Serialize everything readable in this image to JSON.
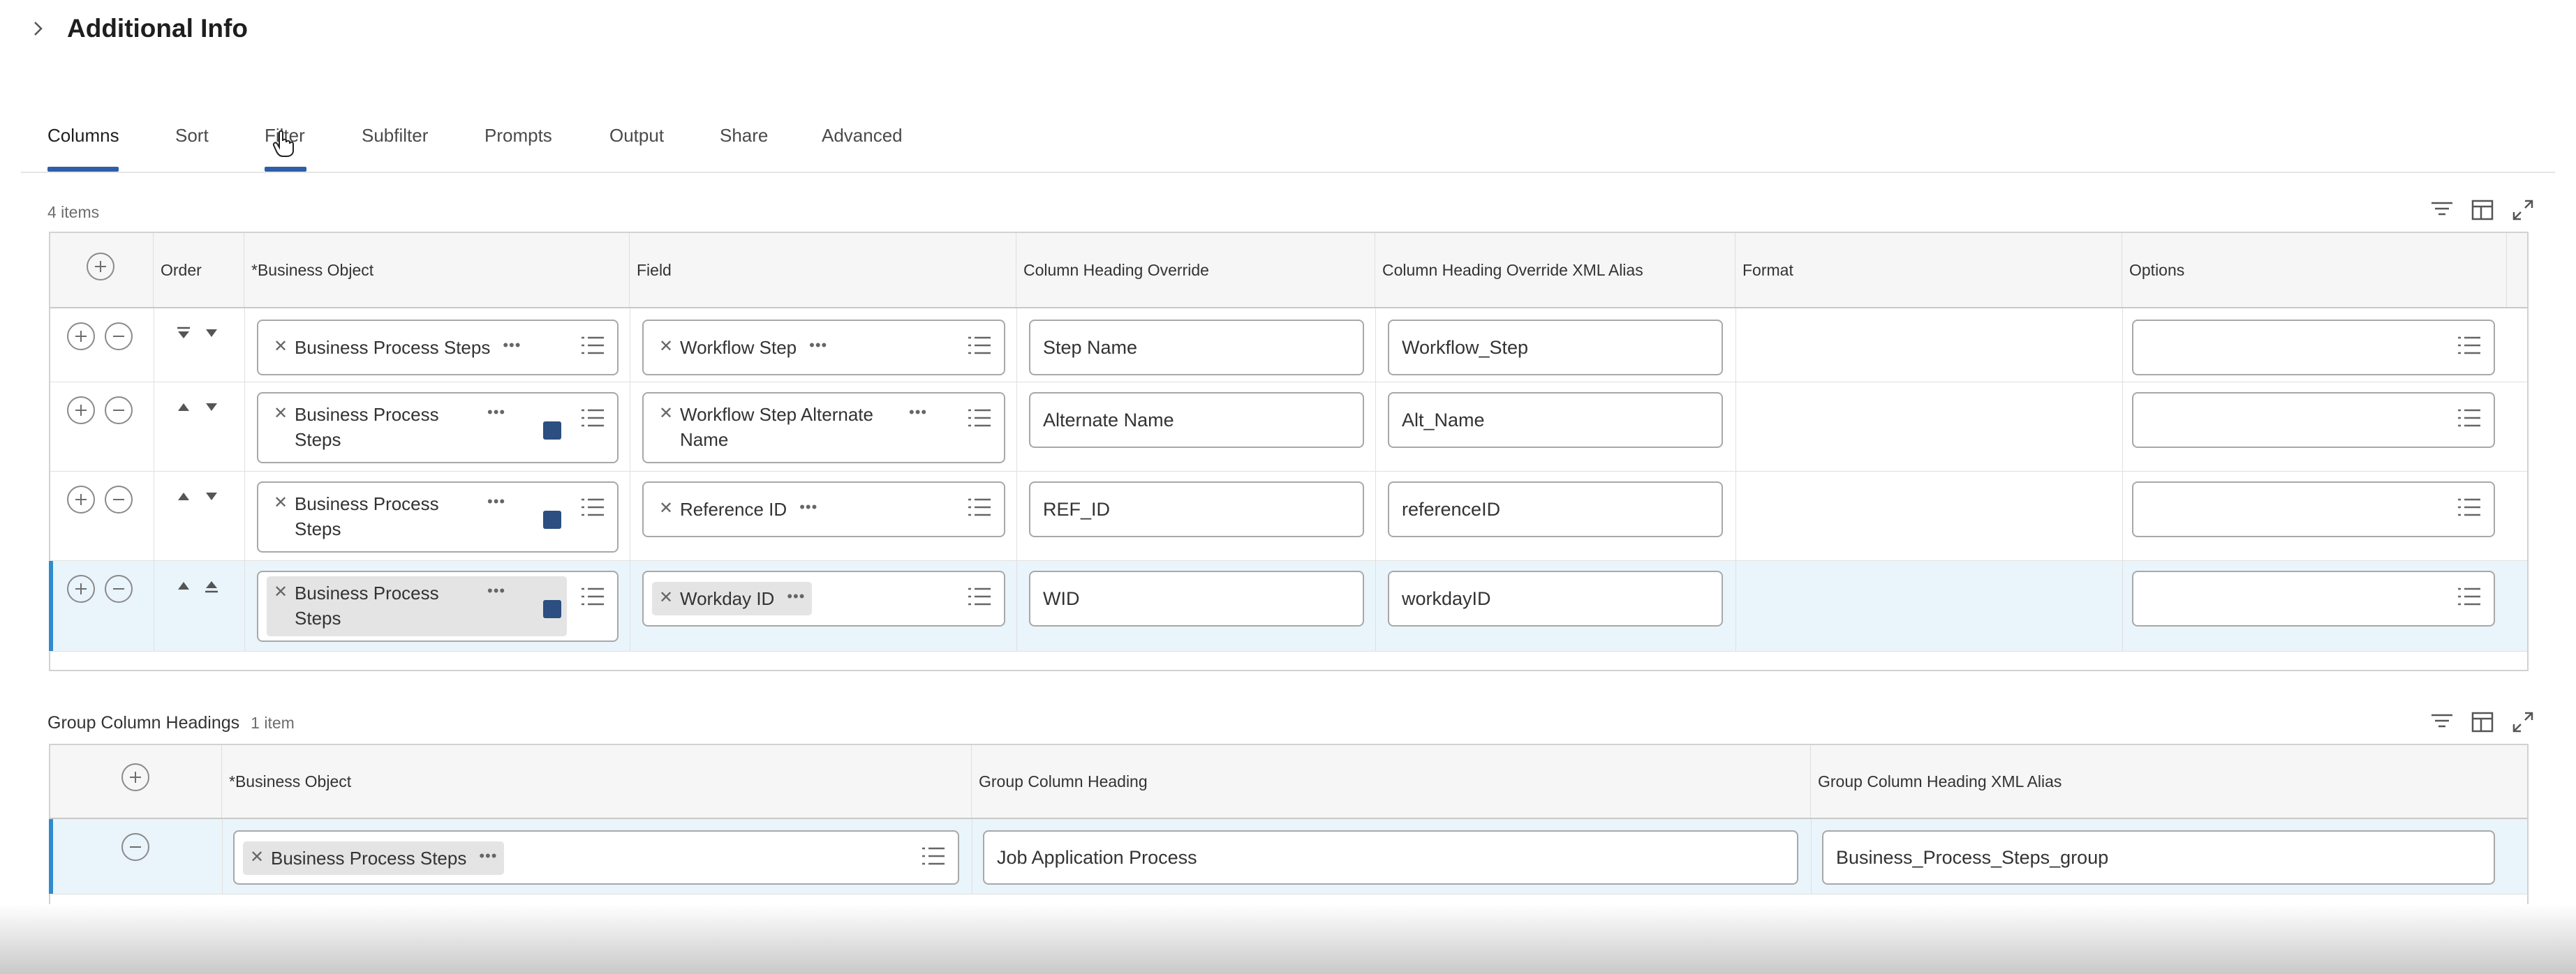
{
  "section": {
    "title": "Additional Info"
  },
  "tabs": [
    {
      "label": "Columns"
    },
    {
      "label": "Sort"
    },
    {
      "label": "Filter"
    },
    {
      "label": "Subfilter"
    },
    {
      "label": "Prompts"
    },
    {
      "label": "Output"
    },
    {
      "label": "Share"
    },
    {
      "label": "Advanced"
    }
  ],
  "active_tab": "Columns",
  "columns_grid": {
    "count": "4 items",
    "headers": {
      "order": "Order",
      "business_object": "*Business Object",
      "field": "Field",
      "column_heading_override": "Column Heading Override",
      "xml_alias": "Column Heading Override XML Alias",
      "format": "Format",
      "options": "Options"
    },
    "rows": [
      {
        "business_object": "Business Process Steps",
        "field": "Workflow Step",
        "heading": "Step Name",
        "alias": "Workflow_Step",
        "format": "",
        "options": ""
      },
      {
        "business_object": "Business Process Steps",
        "field": "Workflow Step Alternate Name",
        "heading": "Alternate Name",
        "alias": "Alt_Name",
        "format": "",
        "options": ""
      },
      {
        "business_object": "Business Process Steps",
        "field": "Reference ID",
        "heading": "REF_ID",
        "alias": "referenceID",
        "format": "",
        "options": ""
      },
      {
        "business_object": "Business Process Steps",
        "field": "Workday ID",
        "heading": "WID",
        "alias": "workdayID",
        "format": "",
        "options": ""
      }
    ]
  },
  "group_grid": {
    "title": "Group Column Headings",
    "count": "1 item",
    "headers": {
      "business_object": "*Business Object",
      "group_heading": "Group Column Heading",
      "group_alias": "Group Column Heading XML Alias"
    },
    "rows": [
      {
        "business_object": "Business Process Steps",
        "group_heading": "Job Application Process",
        "group_alias": "Business_Process_Steps_group"
      }
    ]
  },
  "icons": {
    "expand": "chevron-right-icon",
    "filter": "filter-icon",
    "layout": "table-layout-icon",
    "fullscreen": "fullscreen-icon",
    "add": "plus-circle-icon",
    "remove": "minus-circle-icon",
    "prompt": "list-prompt-icon",
    "related_actions": "ellipsis-icon",
    "badge": "related-object-badge-icon"
  },
  "colors": {
    "accent": "#2e5ea8",
    "selected_row": "#eaf4fb",
    "selected_bar": "#2e8bd0",
    "badge": "#2c4e80"
  }
}
